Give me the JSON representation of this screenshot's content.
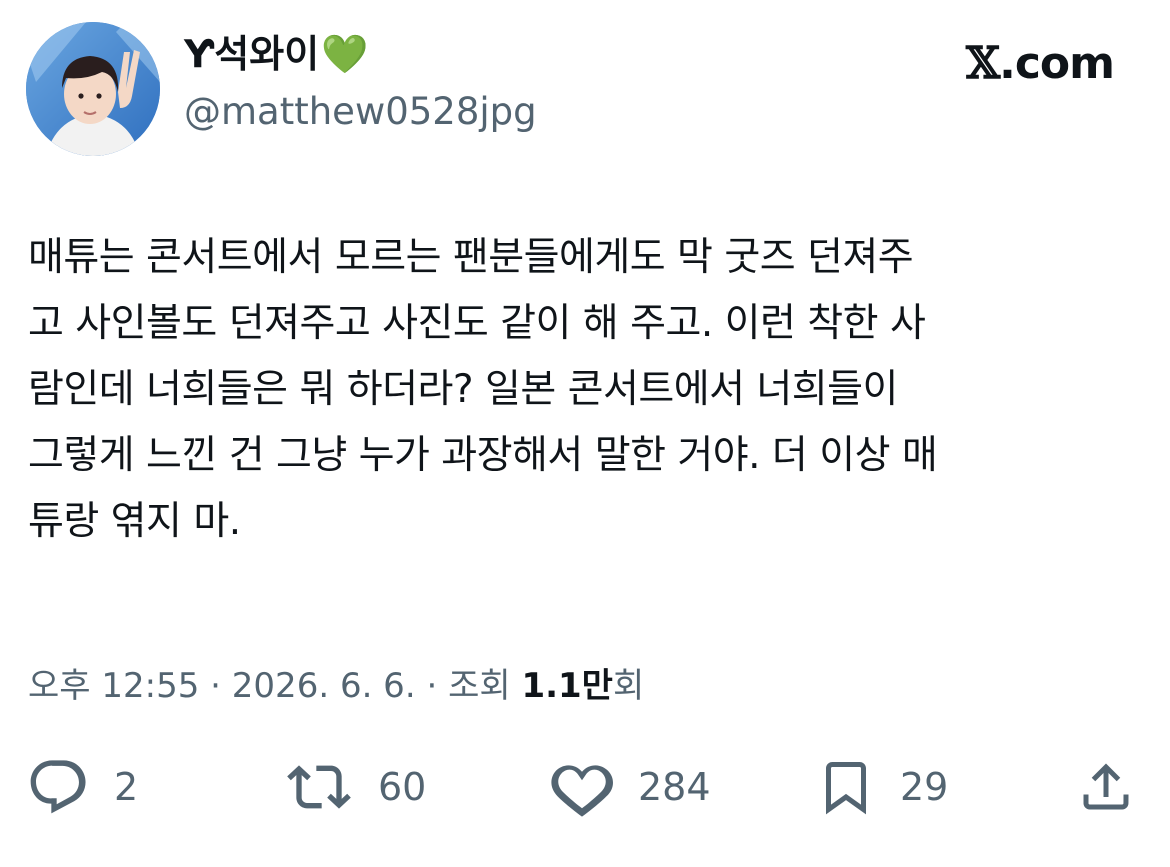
{
  "author": {
    "display_name": "Ƴ석와이",
    "name_emoji": "💚",
    "handle": "@matthew0528jpg",
    "avatar_icon": "profile-photo"
  },
  "brand": {
    "label": "𝕏.com",
    "x": "𝕏",
    "rest": ".com"
  },
  "tweet": {
    "text": "매튜는 콘서트에서 모르는 팬분들에게도 막 굿즈 던져주\n고 사인볼도 던져주고 사진도 같이 해 주고. 이런 착한 사\n람인데 너희들은 뭐 하더라? 일본 콘서트에서 너희들이\n그렇게 느낀 건 그냥 누가 과장해서 말한 거야. 더 이상 매\n튜랑 엮지 마."
  },
  "meta": {
    "time": "오후 12:55",
    "sep1": " · ",
    "date": "2026. 6. 6.",
    "sep2": " · ",
    "views_label": "조회 ",
    "views_count": "1.1만",
    "views_suffix": "회"
  },
  "actions": {
    "reply": {
      "icon": "reply-icon",
      "count": "2"
    },
    "retweet": {
      "icon": "retweet-icon",
      "count": "60"
    },
    "like": {
      "icon": "heart-icon",
      "count": "284"
    },
    "bookmark": {
      "icon": "bookmark-icon",
      "count": "29"
    },
    "share": {
      "icon": "share-icon"
    }
  },
  "colors": {
    "text": "#0f1419",
    "secondary": "#536471",
    "heart": "#3fbf3f"
  }
}
